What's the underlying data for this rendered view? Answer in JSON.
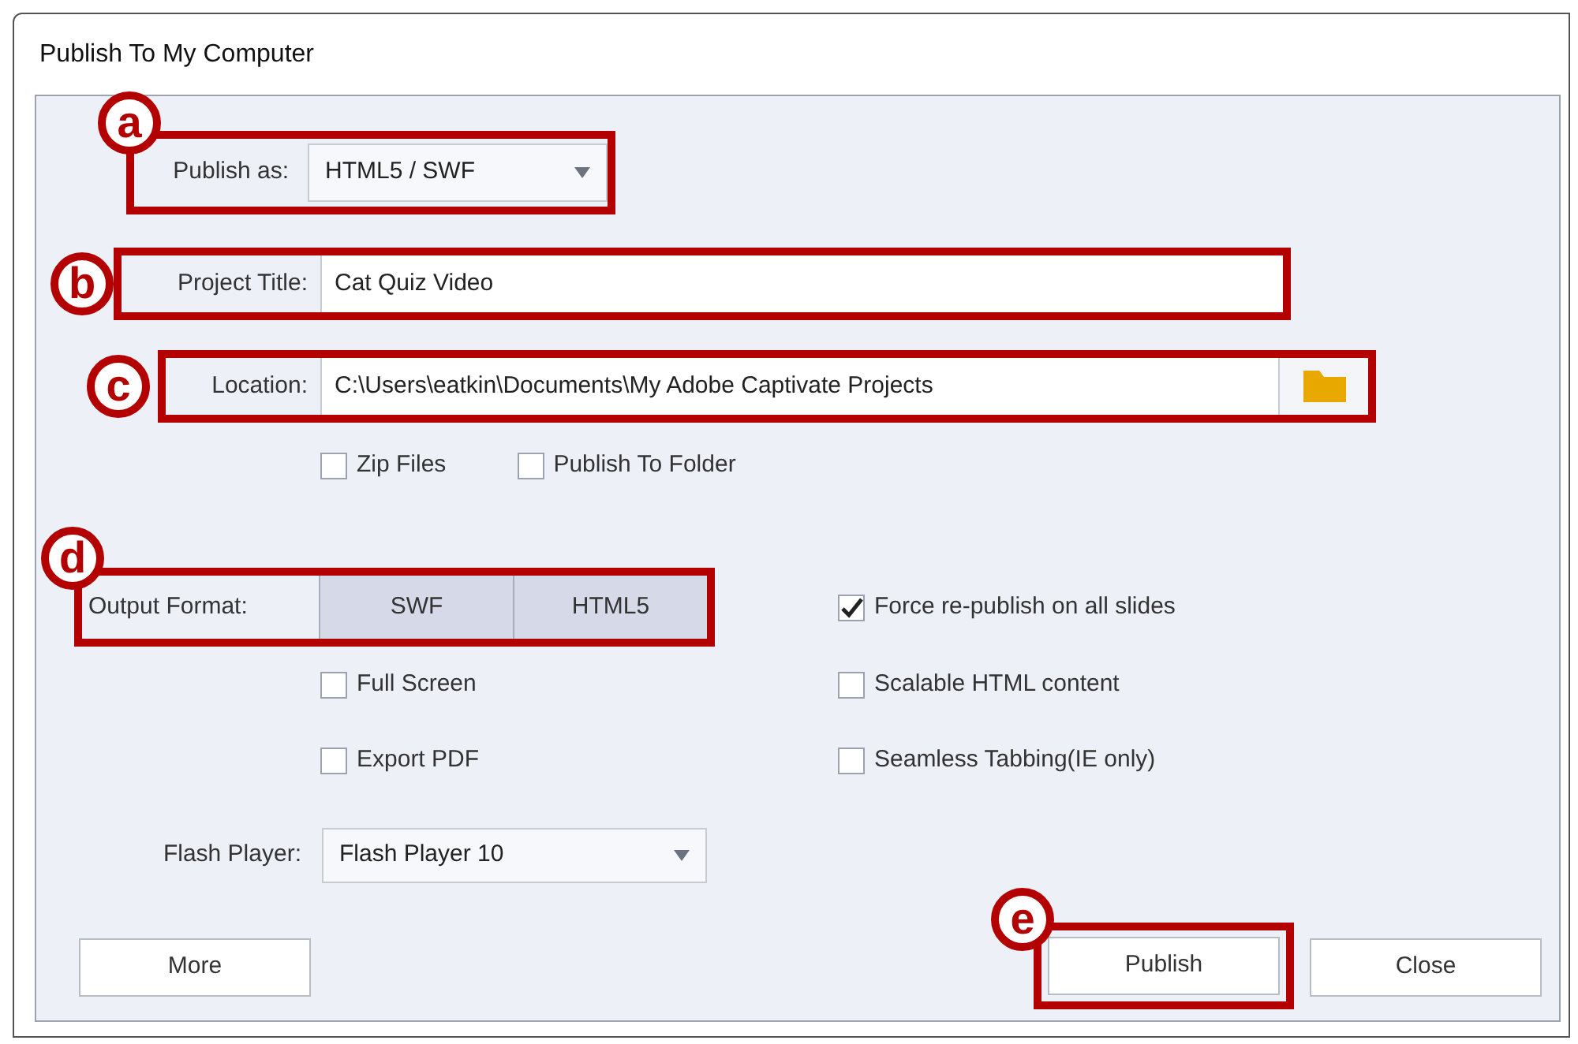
{
  "window": {
    "title": "Publish To My Computer"
  },
  "publish_as": {
    "label": "Publish as:",
    "value": "HTML5 / SWF",
    "badge": "a"
  },
  "project_title": {
    "label": "Project Title:",
    "value": "Cat Quiz Video",
    "badge": "b"
  },
  "location": {
    "label": "Location:",
    "value": "C:\\Users\\eatkin\\Documents\\My Adobe Captivate Projects",
    "badge": "c"
  },
  "location_options": [
    {
      "label": "Zip Files",
      "checked": false
    },
    {
      "label": "Publish To Folder",
      "checked": false
    }
  ],
  "output_format": {
    "label": "Output Format:",
    "badge": "d",
    "options": [
      {
        "label": "SWF",
        "selected": true
      },
      {
        "label": "HTML5",
        "selected": true
      }
    ]
  },
  "swf_options": [
    {
      "label": "Full Screen",
      "checked": false
    },
    {
      "label": "Export PDF",
      "checked": false
    }
  ],
  "html_options": [
    {
      "label": "Force re-publish on all slides",
      "checked": true
    },
    {
      "label": "Scalable HTML content",
      "checked": false
    },
    {
      "label": "Seamless Tabbing(IE only)",
      "checked": false
    }
  ],
  "flash_player": {
    "label": "Flash Player:",
    "value": "Flash Player 10"
  },
  "buttons": [
    {
      "label": "More"
    },
    {
      "label": "Publish",
      "badge": "e"
    },
    {
      "label": "Close"
    }
  ]
}
